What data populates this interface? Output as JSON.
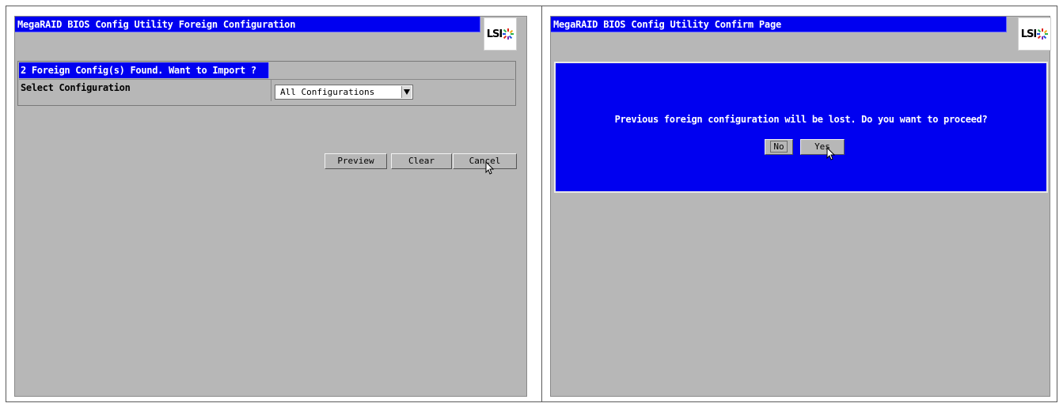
{
  "left_screen": {
    "title": "MegaRAID BIOS Config Utility  Foreign Configuration",
    "logo_text": "LSI",
    "header": "2  Foreign Config(s) Found. Want to Import ?",
    "select_label": "Select Configuration",
    "select_value": "All Configurations",
    "buttons": {
      "preview": "Preview",
      "clear": "Clear",
      "cancel": "Cancel"
    }
  },
  "right_screen": {
    "title": "MegaRAID BIOS Config Utility  Confirm Page",
    "logo_text": "LSI",
    "message": "Previous foreign configuration will be lost. Do you want to proceed?",
    "buttons": {
      "no": "No",
      "yes": "Yes"
    }
  },
  "colors": {
    "title_blue": "#0000f0",
    "panel_gray": "#b7b7b7",
    "text_white": "#ffffff"
  },
  "icons": [
    "lsi-logo-icon",
    "dropdown-arrow-icon",
    "mouse-cursor-icon"
  ]
}
